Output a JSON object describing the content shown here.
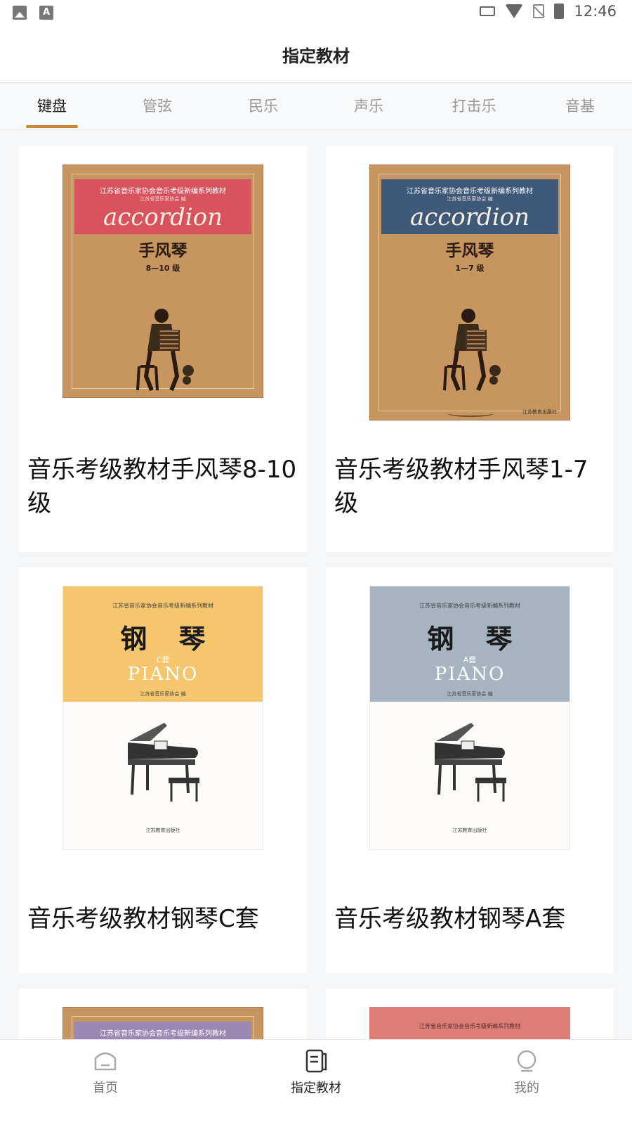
{
  "status_bar": {
    "time": "12:46",
    "icons": [
      "image-icon",
      "a-text-icon",
      "cast-icon",
      "wifi-icon",
      "no-sim-icon",
      "battery-icon"
    ]
  },
  "header": {
    "title": "指定教材"
  },
  "tabs": [
    {
      "label": "键盘",
      "active": true
    },
    {
      "label": "管弦",
      "active": false
    },
    {
      "label": "民乐",
      "active": false
    },
    {
      "label": "声乐",
      "active": false
    },
    {
      "label": "打击乐",
      "active": false
    },
    {
      "label": "音基",
      "active": false
    }
  ],
  "books": [
    {
      "title": "音乐考级教材手风琴8-10级",
      "cover": {
        "series": "江苏省音乐家协会音乐考级新编系列教材",
        "editor": "江苏省音乐家协会 编",
        "english": "accordion",
        "name": "手风琴",
        "level": "8—10 级",
        "band_color": "#d9535f"
      }
    },
    {
      "title": "音乐考级教材手风琴1-7级",
      "cover": {
        "series": "江苏省音乐家协会音乐考级新编系列教材",
        "editor": "江苏省音乐家协会 编",
        "english": "accordion",
        "name": "手风琴",
        "level": "1—7 级",
        "band_color": "#3f5a78",
        "publisher": "江苏教育出版社"
      }
    },
    {
      "title": "音乐考级教材钢琴C套",
      "cover": {
        "series": "江苏省音乐家协会音乐考级新编系列教材",
        "name": "钢 琴",
        "set": "C套",
        "english": "PIANO",
        "editor": "江苏省音乐家协会 编",
        "publisher": "江苏教育出版社",
        "top_color": "#f6c66f"
      }
    },
    {
      "title": "音乐考级教材钢琴A套",
      "cover": {
        "series": "江苏省音乐家协会音乐考级新编系列教材",
        "name": "钢 琴",
        "set": "A套",
        "english": "PIANO",
        "editor": "江苏省音乐家协会 编",
        "publisher": "江苏教育出版社",
        "top_color": "#a7b4bf"
      }
    },
    {
      "title": "",
      "cover": {
        "series": "江苏省音乐家协会音乐考级新编系列教材",
        "band_color": "#9a87b4"
      }
    },
    {
      "title": "",
      "cover": {
        "series": "江苏省音乐家协会音乐考级新编系列教材",
        "band_color": "#de7e78"
      }
    }
  ],
  "bottom_nav": [
    {
      "label": "首页",
      "icon": "home-icon",
      "active": false
    },
    {
      "label": "指定教材",
      "icon": "textbook-icon",
      "active": true
    },
    {
      "label": "我的",
      "icon": "profile-icon",
      "active": false
    }
  ],
  "colors": {
    "accent": "#c88a3a",
    "tab_inactive": "#999999",
    "page_bg": "#f5f6f8"
  }
}
